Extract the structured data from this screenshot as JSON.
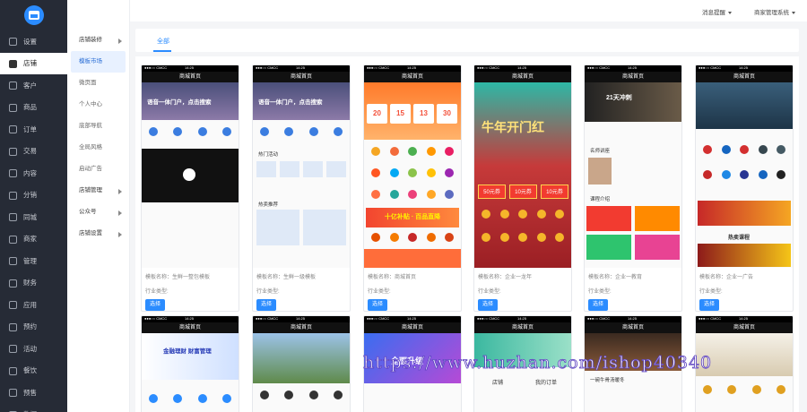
{
  "sidebar": {
    "items": [
      {
        "label": "设置",
        "icon": "gear-icon"
      },
      {
        "label": "店铺",
        "icon": "store-icon",
        "active": true
      },
      {
        "label": "客户",
        "icon": "user-icon"
      },
      {
        "label": "商品",
        "icon": "goods-icon"
      },
      {
        "label": "订单",
        "icon": "order-icon"
      },
      {
        "label": "交易",
        "icon": "trade-icon"
      },
      {
        "label": "内容",
        "icon": "content-icon"
      },
      {
        "label": "分销",
        "icon": "share-icon"
      },
      {
        "label": "同城",
        "icon": "city-icon"
      },
      {
        "label": "商家",
        "icon": "merchant-icon"
      },
      {
        "label": "管理",
        "icon": "manage-icon"
      },
      {
        "label": "财务",
        "icon": "finance-icon"
      },
      {
        "label": "应用",
        "icon": "apps-icon"
      },
      {
        "label": "预约",
        "icon": "booking-icon"
      },
      {
        "label": "活动",
        "icon": "activity-icon"
      },
      {
        "label": "餐饮",
        "icon": "dining-icon"
      },
      {
        "label": "预售",
        "icon": "presale-icon"
      },
      {
        "label": "数据",
        "icon": "data-icon"
      }
    ]
  },
  "submenu": {
    "items": [
      {
        "label": "店铺装修",
        "group": true,
        "caret": true
      },
      {
        "label": "模板市场",
        "selected": true
      },
      {
        "label": "微页面"
      },
      {
        "label": "个人中心"
      },
      {
        "label": "底部导航"
      },
      {
        "label": "全局风格"
      },
      {
        "label": "启动广告"
      },
      {
        "label": "店铺管理",
        "group": true,
        "caret": true
      },
      {
        "label": "公众号",
        "group": true,
        "caret": true
      },
      {
        "label": "店铺设置",
        "group": true,
        "caret": true
      }
    ]
  },
  "topbar": {
    "notice": "消息提醒",
    "account": "商家管理系统"
  },
  "tabs": [
    "全部"
  ],
  "templates": {
    "name_prefix": "模板名称：",
    "industry_label": "行业类型:",
    "select_label": "选择",
    "app_title": "商城首页",
    "carrier": "●●●○○ CMCC",
    "time": "14:25",
    "cards": [
      {
        "name": "模板名称：生鲜一整包模板",
        "industry": "行业类型:",
        "theme": "video-banner",
        "banner_text": "语音一体门户，点击搜索"
      },
      {
        "name": "模板名称：生鲜一级模板",
        "industry": "行业类型:",
        "theme": "image-grid",
        "banner_text": "语音一体门户，点击搜索",
        "section1": "热门活动",
        "section2": "热卖推荐"
      },
      {
        "name": "模板名称：商城首页",
        "industry": "行业类型:",
        "theme": "orange-coupons",
        "coupons": [
          "20",
          "15",
          "13",
          "30"
        ],
        "promo": "十亿补贴 · 百品直降"
      },
      {
        "name": "模板名称：企业一龙年",
        "industry": "行业类型:",
        "theme": "new-year",
        "headline": "牛年开门红",
        "coupons": [
          "50元券",
          "10元券",
          "10元券"
        ]
      },
      {
        "name": "模板名称：企业一教育",
        "industry": "行业类型:",
        "theme": "education",
        "banner_text": "21天冲刺",
        "section1": "名师讲座",
        "section2": "课程介绍"
      },
      {
        "name": "模板名称：企业一广告",
        "industry": "行业类型:",
        "theme": "party-red",
        "banner_text": "热卖课程"
      },
      {
        "name": "",
        "industry": "",
        "theme": "finance-blue",
        "banner_text": "金融理财 财富管理"
      },
      {
        "name": "",
        "industry": "",
        "theme": "campus",
        "banner_text": "商城首页"
      },
      {
        "name": "",
        "industry": "",
        "theme": "upgrade",
        "banner_text": "全面升级"
      },
      {
        "name": "",
        "industry": "",
        "theme": "teal-store",
        "labels": [
          "店铺",
          "我的订单"
        ]
      },
      {
        "name": "",
        "industry": "",
        "theme": "food",
        "banner_text": "一碗牛骨汤暖冬"
      },
      {
        "name": "",
        "industry": "",
        "theme": "drinks",
        "banner_text": "商城首页"
      }
    ]
  },
  "watermark": "https://www.huzhan.com/ishop40340",
  "colors": {
    "primary": "#2b8cff",
    "sidebar_bg": "#262b36"
  }
}
